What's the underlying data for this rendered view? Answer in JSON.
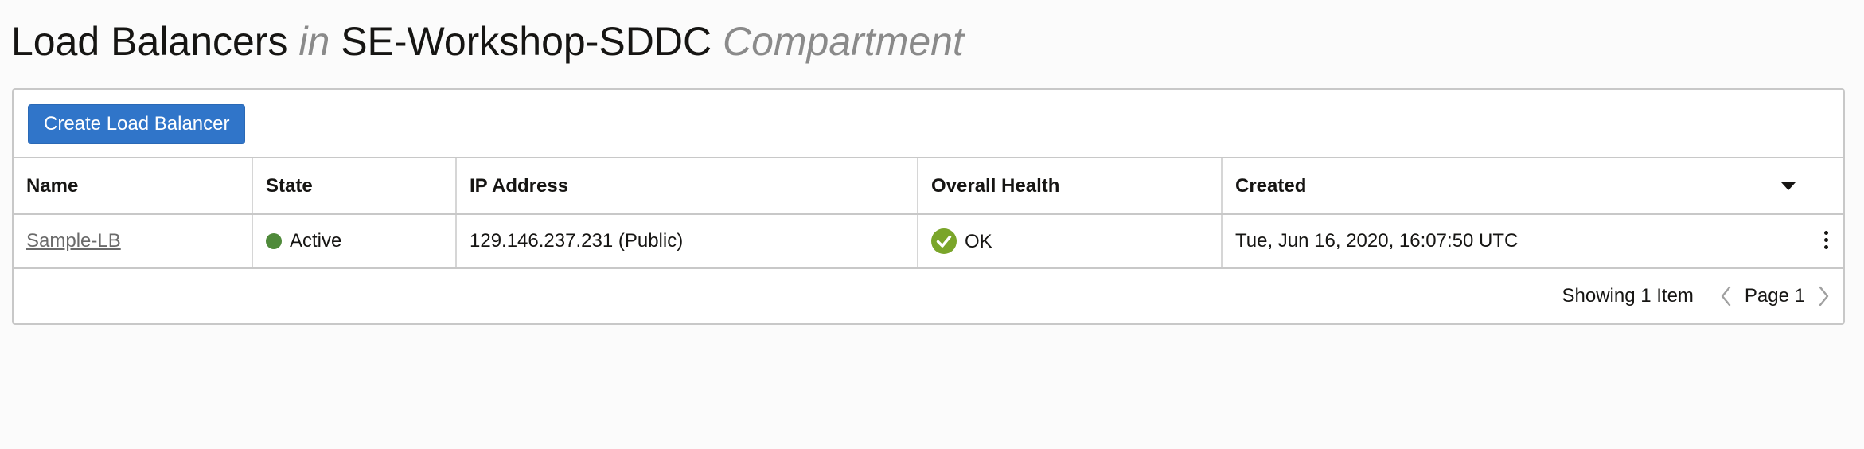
{
  "header": {
    "title": "Load Balancers",
    "in_word": "in",
    "compartment_name": "SE-Workshop-SDDC",
    "compartment_word": "Compartment"
  },
  "toolbar": {
    "create_label": "Create Load Balancer"
  },
  "table": {
    "columns": [
      "Name",
      "State",
      "IP Address",
      "Overall Health",
      "Created"
    ],
    "rows": [
      {
        "name": "Sample-LB",
        "state": "Active",
        "ip": "129.146.237.231 (Public)",
        "health": "OK",
        "created": "Tue, Jun 16, 2020, 16:07:50 UTC"
      }
    ]
  },
  "footer": {
    "count_text": "Showing 1 Item",
    "page_text": "Page 1"
  },
  "colors": {
    "primary_button": "#3075c9",
    "state_active": "#4f8a3a",
    "health_ok": "#7aa52a"
  },
  "icons": {
    "state": "status-dot-icon",
    "health": "check-circle-icon",
    "sort": "caret-down-icon",
    "row_actions": "kebab-menu-icon",
    "prev": "chevron-left-icon",
    "next": "chevron-right-icon"
  }
}
